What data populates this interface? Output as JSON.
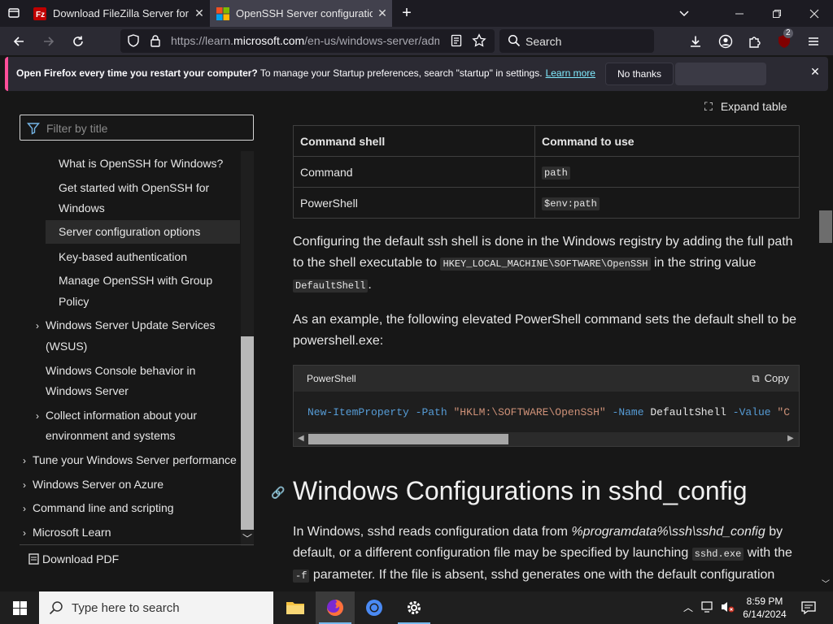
{
  "browser": {
    "tabs": [
      {
        "title": "Download FileZilla Server for Wi",
        "favicon": "filezilla-icon",
        "active": false
      },
      {
        "title": "OpenSSH Server configuration f",
        "favicon": "microsoft-icon",
        "active": true
      }
    ],
    "url_domain_prefix": "https://learn.",
    "url_domain": "microsoft.com",
    "url_path": "/en-us/windows-server/adm",
    "search_placeholder": "Search",
    "notification_badge": "2"
  },
  "notification": {
    "bold": "Open Firefox every time you restart your computer?",
    "text": " To manage your Startup preferences, search \"startup\" in settings.",
    "link": "Learn more",
    "no_thanks": "No thanks"
  },
  "sidebar": {
    "filter_placeholder": "Filter by title",
    "items": [
      {
        "label": "What is OpenSSH for Windows?"
      },
      {
        "label": "Get started with OpenSSH for"
      },
      {
        "label": "Windows"
      },
      {
        "label": "Server configuration options"
      },
      {
        "label": "Key-based authentication"
      },
      {
        "label": "Manage OpenSSH with Group"
      },
      {
        "label": "Policy"
      },
      {
        "label": "Windows Server Update Services"
      },
      {
        "label": "(WSUS)"
      },
      {
        "label": "Windows Console behavior in"
      },
      {
        "label": "Windows Server"
      },
      {
        "label": "Collect information about your"
      },
      {
        "label": "environment and systems"
      },
      {
        "label": "Tune your Windows Server performance"
      },
      {
        "label": "Windows Server on Azure"
      },
      {
        "label": "Command line and scripting"
      },
      {
        "label": "Microsoft Learn"
      }
    ],
    "download_pdf": "Download PDF"
  },
  "content": {
    "expand_table": "Expand table",
    "table": {
      "headers": [
        "Command shell",
        "Command to use"
      ],
      "rows": [
        [
          "Command",
          "path"
        ],
        [
          "PowerShell",
          "$env:path"
        ]
      ]
    },
    "para1_a": "Configuring the default ssh shell is done in the Windows registry by adding the full path to the shell executable to ",
    "para1_code1": "HKEY_LOCAL_MACHINE\\SOFTWARE\\OpenSSH",
    "para1_b": " in the string value ",
    "para1_code2": "DefaultShell",
    "para1_c": ".",
    "para2": "As an example, the following elevated PowerShell command sets the default shell to be powershell.exe:",
    "code_lang": "PowerShell",
    "code_copy": "Copy",
    "code_cmd": "New-ItemProperty",
    "code_p1": "-Path",
    "code_s1": "\"HKLM:\\SOFTWARE\\OpenSSH\"",
    "code_p2": "-Name",
    "code_t1": "DefaultShell",
    "code_p3": "-Value",
    "code_s2": "\"C",
    "heading": "Windows Configurations in sshd_config",
    "para3_a": "In Windows, sshd reads configuration data from ",
    "para3_em": "%programdata%\\ssh\\sshd_config",
    "para3_b": " by default, or a different configuration file may be specified by launching ",
    "para3_code1": "sshd.exe",
    "para3_c": " with the ",
    "para3_code2": "-f",
    "para3_d": " parameter. If the file is absent, sshd generates one with the default configuration"
  },
  "taskbar": {
    "search_placeholder": "Type here to search",
    "time": "8:59 PM",
    "date": "6/14/2024"
  },
  "colors": {
    "accent_pink": "#ff4f9a",
    "link": "#80ebff"
  }
}
